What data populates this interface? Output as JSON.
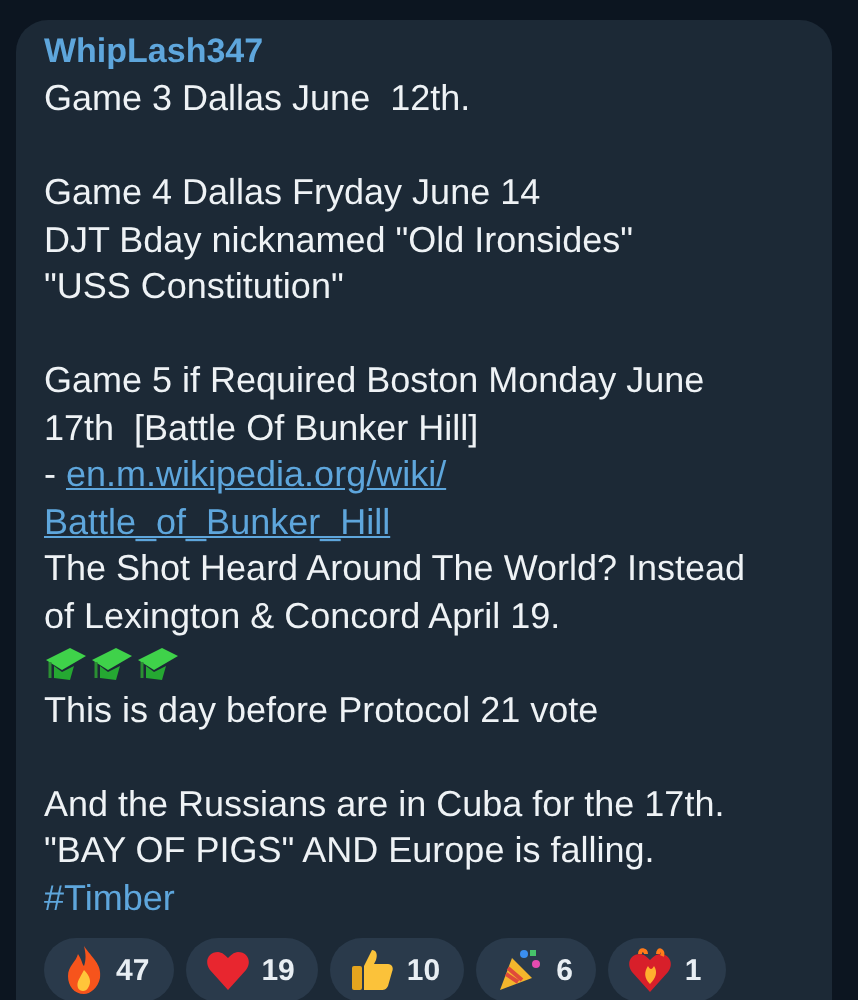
{
  "message": {
    "author": "WhipLash347",
    "lines": [
      {
        "kind": "text",
        "text": "Game 3 Dallas June  12th."
      },
      {
        "kind": "blank"
      },
      {
        "kind": "text",
        "text": "Game 4 Dallas Fryday June 14"
      },
      {
        "kind": "text",
        "text": "DJT Bday nicknamed \"Old Ironsides\""
      },
      {
        "kind": "text",
        "text": "\"USS Constitution\""
      },
      {
        "kind": "blank"
      },
      {
        "kind": "text",
        "text": "Game 5 if Required Boston Monday June"
      },
      {
        "kind": "text",
        "text": "17th  [Battle Of Bunker Hill]"
      },
      {
        "kind": "link",
        "prefix": "- ",
        "text": "en.m.wikipedia.org/wiki/"
      },
      {
        "kind": "link",
        "text": "Battle_of_Bunker_Hill"
      },
      {
        "kind": "text",
        "text": "The Shot Heard Around The World? Instead"
      },
      {
        "kind": "text",
        "text": "of Lexington & Concord April 19."
      },
      {
        "kind": "emoji",
        "emoji": [
          {
            "kind": "cap"
          },
          {
            "kind": "cap"
          },
          {
            "kind": "cap"
          }
        ]
      },
      {
        "kind": "text",
        "text": "This is day before Protocol 21 vote"
      },
      {
        "kind": "blank"
      },
      {
        "kind": "text",
        "text": "And the Russians are in Cuba for the 17th."
      },
      {
        "kind": "text",
        "text": "\"BAY OF PIGS\" AND Europe is falling."
      },
      {
        "kind": "hashtag",
        "text": "#Timber"
      }
    ],
    "reactions": [
      {
        "kind": "fire",
        "count": "47"
      },
      {
        "kind": "heart",
        "count": "19"
      },
      {
        "kind": "thumb",
        "count": "10"
      },
      {
        "kind": "party",
        "count": "6"
      },
      {
        "kind": "fireheart",
        "count": "1"
      }
    ]
  }
}
